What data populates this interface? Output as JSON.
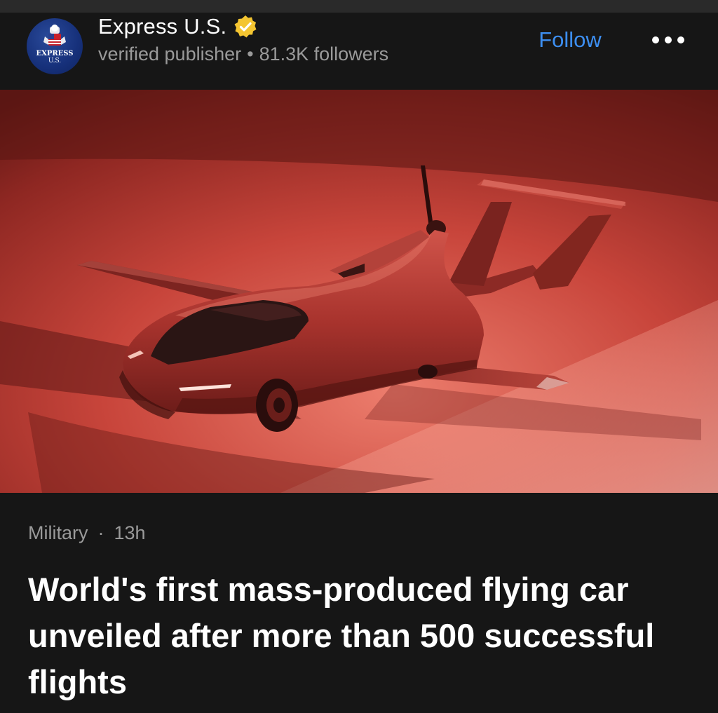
{
  "publisher": {
    "name": "Express U.S.",
    "logo_text_line1": "EXPRESS",
    "logo_text_line2": "U.S.",
    "verified_icon": "verified-badge-icon",
    "status": "verified publisher",
    "separator": "•",
    "followers": "81.3K followers",
    "follow_label": "Follow",
    "more_icon": "more-options-icon"
  },
  "hero_image": {
    "subject": "flying-car",
    "description_icon": "flying-car-image"
  },
  "article": {
    "category": "Military",
    "separator": "·",
    "age": "13h",
    "headline": "World's first mass-produced flying car unveiled after more than 500 successful flights"
  },
  "colors": {
    "background": "#161616",
    "accent": "#3d8ef0",
    "verified": "#f4c531",
    "meta_text": "#9a9a9a"
  }
}
